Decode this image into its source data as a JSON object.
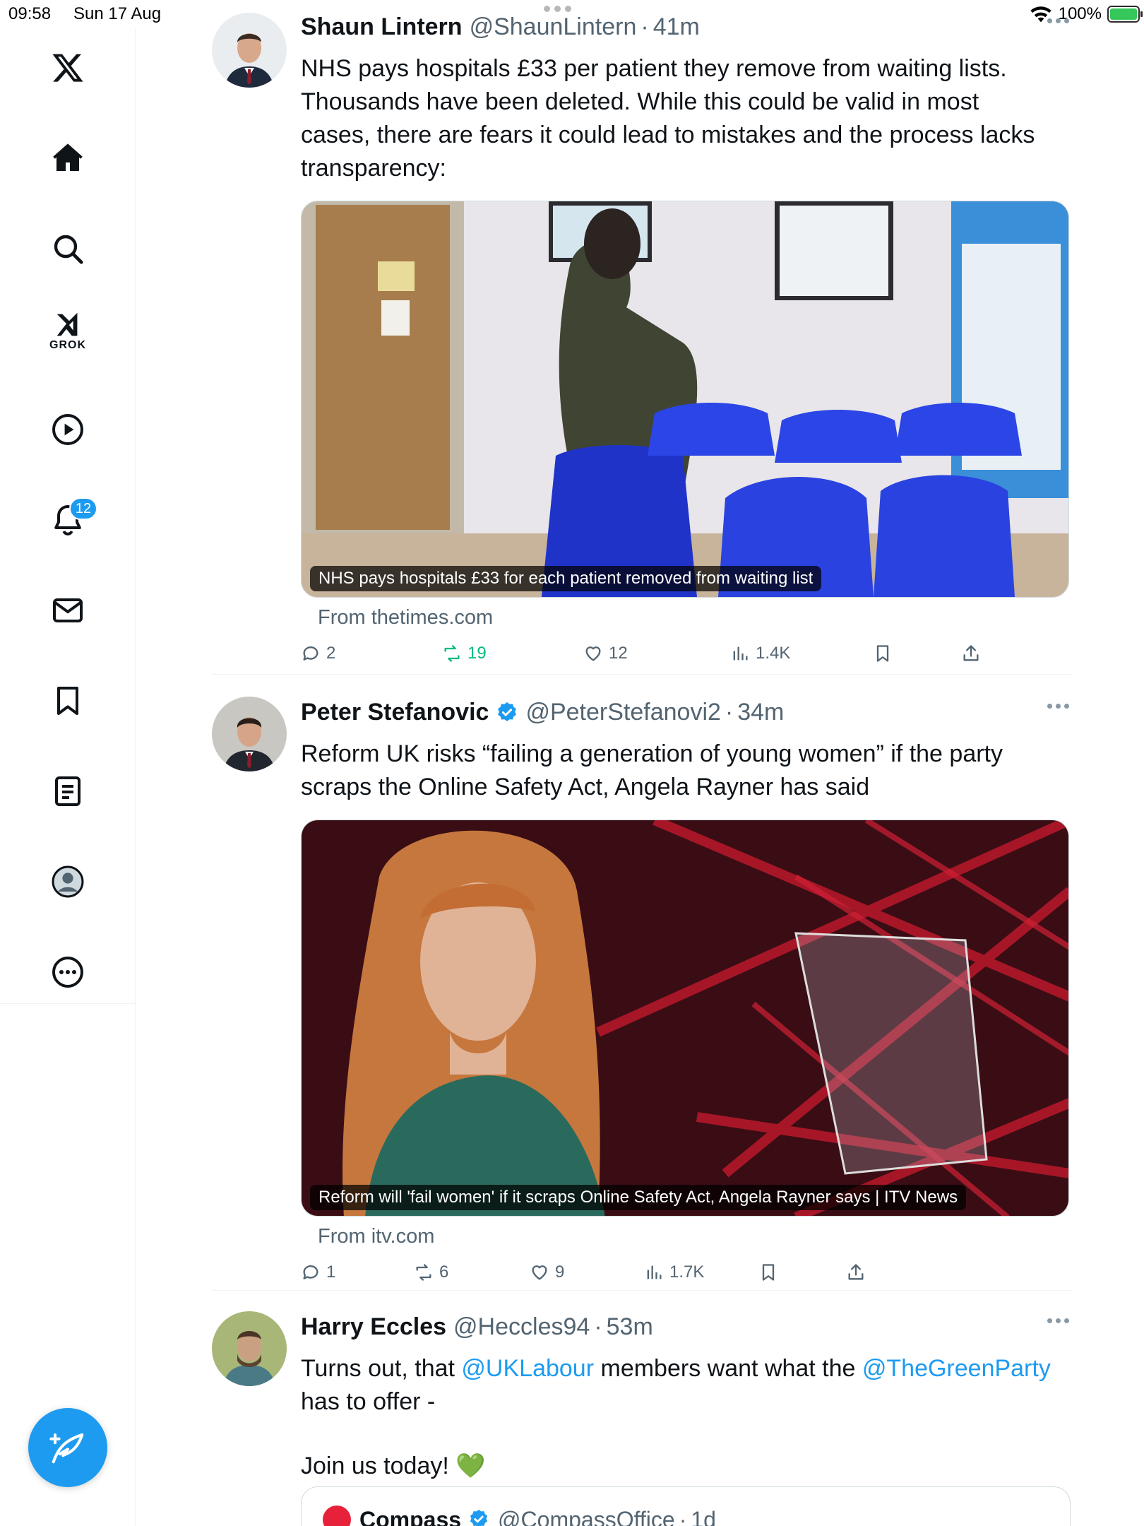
{
  "status_bar": {
    "time": "09:58",
    "date": "Sun 17 Aug",
    "battery": "100%"
  },
  "sidebar": {
    "grok_label": "GROK",
    "notification_count": "12",
    "icons": [
      "x-logo-icon",
      "home-icon",
      "search-icon",
      "grok-icon",
      "video-icon",
      "bell-icon",
      "mail-icon",
      "bookmark-icon",
      "lists-icon",
      "profile-icon",
      "more-icon",
      "compose-icon"
    ]
  },
  "feed": {
    "tweets": [
      {
        "name": "Shaun Lintern",
        "handle": "@ShaunLintern",
        "time": "41m",
        "text": "NHS pays hospitals £33 per patient they remove from waiting lists. Thousands have been deleted. While this could be valid in most cases, there are fears it could lead to mistakes and the process lacks transparency:",
        "card_caption": "NHS pays hospitals £33 for each patient removed from waiting list",
        "card_source": "From thetimes.com",
        "replies": "2",
        "retweets": "19",
        "likes": "12",
        "views": "1.4K"
      },
      {
        "name": "Peter Stefanovic",
        "handle": "@PeterStefanovi2",
        "time": "34m",
        "text": "Reform UK risks “failing a generation of young women” if the party scraps the Online Safety Act, Angela Rayner has said",
        "card_caption": "Reform will 'fail women' if it scraps Online Safety Act, Angela Rayner says | ITV News",
        "card_source": "From itv.com",
        "replies": "1",
        "retweets": "6",
        "likes": "9",
        "views": "1.7K"
      },
      {
        "name": "Harry Eccles",
        "handle": "@Heccles94",
        "time": "53m",
        "text_part1": "Turns out, that ",
        "mention1": "@UKLabour",
        "text_part2": " members want what the ",
        "mention2": "@TheGreenParty",
        "text_part3": " has to offer -",
        "text_line2": "Join us today! 💚",
        "quote": {
          "name": "Compass",
          "handle": "@CompassOffice",
          "time": "1d"
        }
      }
    ]
  },
  "colors": {
    "accent": "#1d9bf0",
    "retweet_green": "#00ba7c",
    "muted": "#536471"
  }
}
